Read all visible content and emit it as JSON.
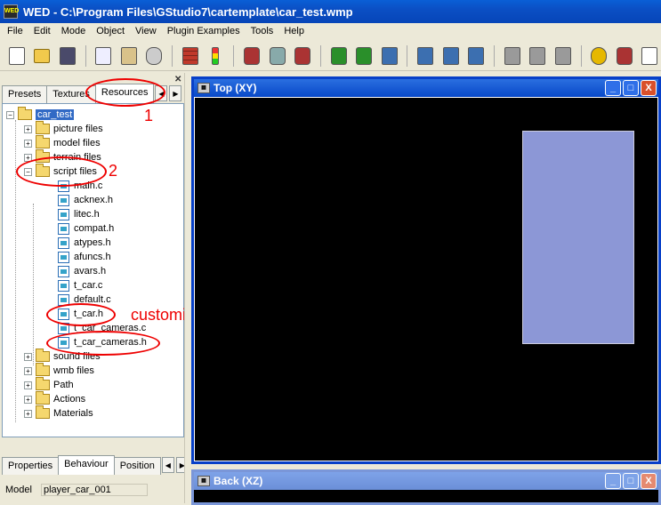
{
  "window": {
    "title": "WED - C:\\Program Files\\GStudio7\\cartemplate\\car_test.wmp",
    "icon": "wed-app-icon"
  },
  "menu": [
    "File",
    "Edit",
    "Mode",
    "Object",
    "View",
    "Plugin Examples",
    "Tools",
    "Help"
  ],
  "toolbar": {
    "icons": [
      "new-file-icon",
      "open-folder-icon",
      "save-disk-icon",
      "copy-icon",
      "paste-icon",
      "undo-icon",
      "bricks-icon",
      "traffic-light-icon",
      "add-entity-icon",
      "shield-icon",
      "cube-red-icon",
      "move-arrow-icon",
      "rotate-icon",
      "scale-icon",
      "block-icon",
      "door-icon",
      "path-icon",
      "sound-icon",
      "light-icon",
      "cube-grey-icon",
      "cube-white-icon",
      "camera-icon",
      "plus-shield-icon",
      "new-doc-icon"
    ]
  },
  "left_panel": {
    "tabs": [
      "Presets",
      "Textures",
      "Resources"
    ],
    "active_tab": "Resources",
    "tree": {
      "root": "car_test",
      "folders_top": [
        "picture files",
        "model files",
        "terrain files",
        "script files"
      ],
      "script_files": [
        "main.c",
        "acknex.h",
        "litec.h",
        "compat.h",
        "atypes.h",
        "afuncs.h",
        "avars.h",
        "t_car.c",
        "default.c",
        "t_car.h",
        "t_car_cameras.c",
        "t_car_cameras.h"
      ],
      "folders_bottom": [
        "sound files",
        "wmb files",
        "Path",
        "Actions",
        "Materials"
      ]
    },
    "bottom_tabs": [
      "Properties",
      "Behaviour",
      "Position"
    ],
    "active_bottom_tab": "Behaviour",
    "model_label": "Model",
    "model_value": "player_car_001"
  },
  "annotations": {
    "num1": "1",
    "num2": "2",
    "note": "customize these files",
    "color": "#e00000"
  },
  "views": {
    "top": {
      "title": "Top (XY)"
    },
    "back": {
      "title": "Back (XZ)"
    },
    "window_buttons": [
      "_",
      "□",
      "X"
    ]
  },
  "colors": {
    "title_blue": "#0b4fc4",
    "model_fill": "#8c97d6",
    "canvas": "#000000"
  }
}
